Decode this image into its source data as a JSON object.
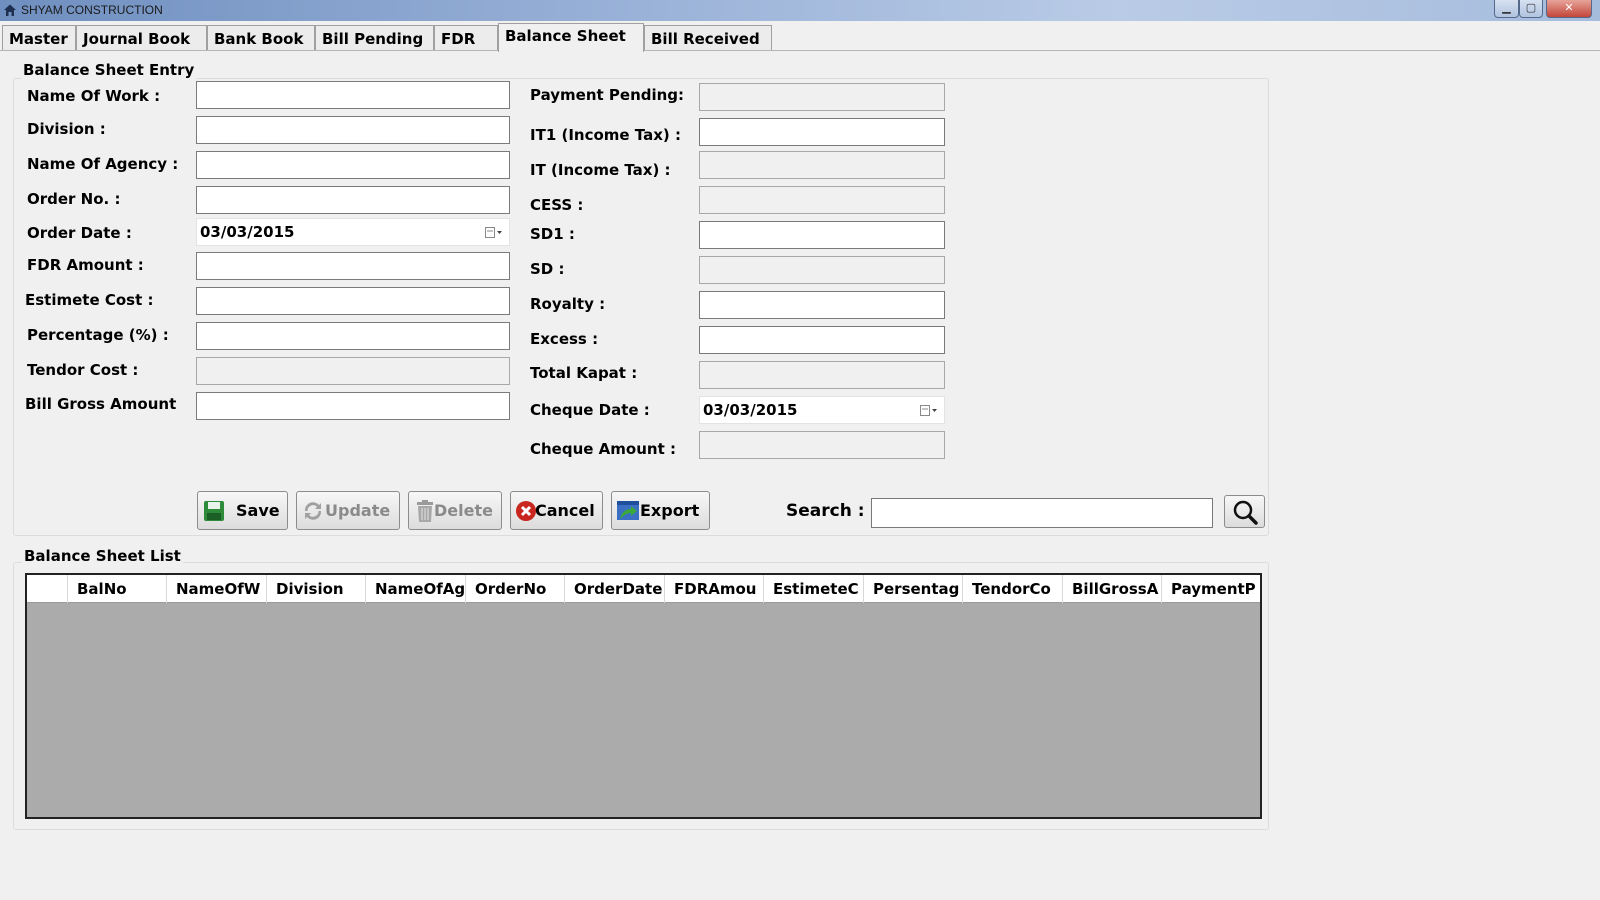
{
  "window": {
    "title": "SHYAM CONSTRUCTION"
  },
  "tabs": [
    {
      "label": "Master"
    },
    {
      "label": "Journal Book"
    },
    {
      "label": "Bank Book"
    },
    {
      "label": "Bill Pending"
    },
    {
      "label": "FDR"
    },
    {
      "label": "Balance Sheet",
      "active": true
    },
    {
      "label": "Bill Received"
    }
  ],
  "entry": {
    "title": "Balance Sheet Entry",
    "left": [
      {
        "label": "Name Of Work :",
        "value": ""
      },
      {
        "label": "Division :",
        "value": ""
      },
      {
        "label": "Name Of Agency :",
        "value": ""
      },
      {
        "label": "Order No. :",
        "value": ""
      },
      {
        "label": "Order Date :",
        "value": "03/03/2015"
      },
      {
        "label": "FDR Amount :",
        "value": ""
      },
      {
        "label": "Estimete Cost :",
        "value": ""
      },
      {
        "label": "Percentage (%) :",
        "value": ""
      },
      {
        "label": "Tendor Cost :",
        "value": ""
      },
      {
        "label": "Bill Gross Amount",
        "value": ""
      }
    ],
    "right": [
      {
        "label": "Payment Pending:",
        "value": ""
      },
      {
        "label": "IT1  (Income Tax) :",
        "value": ""
      },
      {
        "label": "IT  (Income Tax) :",
        "value": ""
      },
      {
        "label": "CESS :",
        "value": ""
      },
      {
        "label": "SD1 :",
        "value": ""
      },
      {
        "label": "SD :",
        "value": ""
      },
      {
        "label": "Royalty :",
        "value": ""
      },
      {
        "label": "Excess :",
        "value": ""
      },
      {
        "label": "Total Kapat :",
        "value": ""
      },
      {
        "label": "Cheque Date :",
        "value": "03/03/2015"
      },
      {
        "label": "Cheque Amount :",
        "value": ""
      }
    ]
  },
  "buttons": {
    "save": "Save",
    "update": "Update",
    "delete": "Delete",
    "cancel": "Cancel",
    "export": "Export"
  },
  "search": {
    "label": "Search :",
    "value": ""
  },
  "list": {
    "title": "Balance Sheet List",
    "columns": [
      "BalNo",
      "NameOfW",
      "Division",
      "NameOfAg",
      "OrderNo",
      "OrderDate",
      "FDRAmou",
      "EstimeteC",
      "Persentag",
      "TendorCo",
      "BillGrossA",
      "PaymentP"
    ],
    "rows": []
  },
  "colors": {
    "window_bg": "#f0f0f0",
    "grid_bg": "#ababab",
    "titlebar": "#9ab2d8"
  }
}
